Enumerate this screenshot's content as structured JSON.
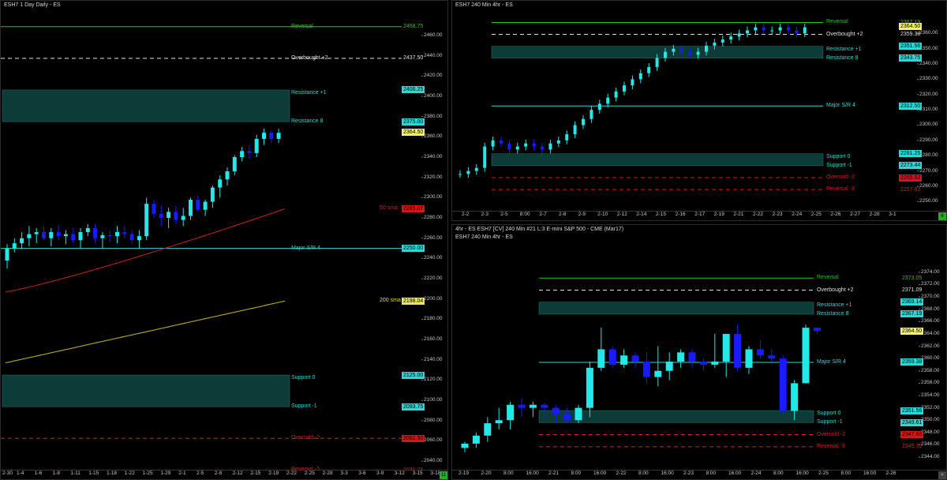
{
  "panels": {
    "daily": {
      "title": "ESH7 1 Day  Daily - ES",
      "levels": [
        {
          "label": "Reversal",
          "price": "2468.75",
          "color": "#22c522",
          "kind": "line",
          "y": 2468.75
        },
        {
          "label": "Overbought +2",
          "price": "2437.50",
          "color": "#e0e0e0",
          "kind": "dash",
          "y": 2437.5
        },
        {
          "label": "Resistance +1",
          "price": "2406.25",
          "color": "#36d3d3",
          "kind": "zone-top",
          "y": 2406.25
        },
        {
          "label": "Resistance 8",
          "price": "2375.00",
          "color": "#36d3d3",
          "kind": "zone-bottom",
          "y": 2375.0
        },
        {
          "label": "Major S/R 4",
          "price": "2250.00",
          "color": "#36d3d3",
          "kind": "line",
          "y": 2250.0
        },
        {
          "label": "Support 0",
          "price": "2125.00",
          "color": "#36d3d3",
          "kind": "zone-top",
          "y": 2125.0
        },
        {
          "label": "Support -1",
          "price": "2093.75",
          "color": "#36d3d3",
          "kind": "zone-bottom",
          "y": 2093.75
        },
        {
          "label": "Oversold -2",
          "price": "2062.50",
          "color": "#d02020",
          "kind": "dash",
          "y": 2062.5
        },
        {
          "label": "Reversal -3",
          "price": "2031.25",
          "color": "#d02020",
          "kind": "dash",
          "y": 2031.25
        }
      ],
      "sma": [
        {
          "label": "50 sma",
          "price": "2289.07",
          "color": "#c8221a"
        },
        {
          "label": "200 sma",
          "price": "2198.04",
          "color": "#b0a020"
        }
      ],
      "last": "2364.50",
      "yticks": [
        "2460.00",
        "2440.00",
        "2420.00",
        "2400.00",
        "2380.00",
        "2360.00",
        "2340.00",
        "2320.00",
        "2300.00",
        "2280.00",
        "2260.00",
        "2240.00",
        "2220.00",
        "2200.00",
        "2180.00",
        "2160.00",
        "2140.00",
        "2120.00",
        "2100.00",
        "2080.00",
        "2060.00",
        "2040.00"
      ],
      "xticks": [
        "1-4",
        "1-6",
        "1-8",
        "1-11",
        "1-15",
        "1-18",
        "1-22",
        "1-25",
        "1-29",
        "2-1",
        "2-5",
        "2-8",
        "2-12",
        "2-15",
        "2-19",
        "2-22",
        "2-25",
        "2-28",
        "3-3",
        "3-6",
        "3-9",
        "3-12",
        "3-15",
        "3-18"
      ],
      "xfirst": "2-30",
      "corner": "11"
    },
    "h4top": {
      "title": "ESH7 240 Min  4hr - ES",
      "levels": [
        {
          "label": "Reversal",
          "price": "2367.19",
          "color": "#22c522",
          "kind": "line"
        },
        {
          "label": "Overbought +2",
          "price": "2359.38",
          "color": "#e0e0e0",
          "kind": "dash"
        },
        {
          "label": "Resistance +1",
          "price": "2351.56",
          "color": "#36d3d3",
          "kind": "zone-top"
        },
        {
          "label": "Resistance 8",
          "price": "2343.75",
          "color": "#36d3d3",
          "kind": "zone-bottom"
        },
        {
          "label": "Major S/R 4",
          "price": "2312.50",
          "color": "#36d3d3",
          "kind": "line"
        },
        {
          "label": "Support 0",
          "price": "2281.25",
          "color": "#36d3d3",
          "kind": "zone-top"
        },
        {
          "label": "Support -1",
          "price": "2273.44",
          "color": "#36d3d3",
          "kind": "zone-bottom"
        },
        {
          "label": "Oversold -2",
          "price": "2265.63",
          "color": "#d02020",
          "kind": "dash"
        },
        {
          "label": "Reversal -3",
          "price": "2257.81",
          "color": "#d02020",
          "kind": "dash"
        }
      ],
      "last": "2364.50",
      "yticks": [
        "2360.00",
        "2350.00",
        "2340.00",
        "2330.00",
        "2320.00",
        "2310.00",
        "2300.00",
        "2290.00",
        "2280.00",
        "2270.00",
        "2260.00",
        "2250.00"
      ],
      "xticks": [
        "2-2",
        "2-3",
        "2-5",
        "8:00",
        "2-7",
        "2-8",
        "2-9",
        "2-10",
        "2-12",
        "2-14",
        "2-15",
        "2-16",
        "2-17",
        "2-19",
        "2-21",
        "2-22",
        "2-23",
        "2-24",
        "2-25",
        "2-26",
        "2-27",
        "2-28",
        "3-1"
      ],
      "corner": "6"
    },
    "h4bot": {
      "title": "4hr - ES  ESH7 [CV]  240 Min  #21  L:3  E-mini S&P 500 - CME (Mar17)",
      "subtitle": "ESH7 240 Min  4hr - ES",
      "levels": [
        {
          "label": "Reversal",
          "price": "2373.05",
          "color": "#22c522",
          "kind": "line"
        },
        {
          "label": "Overbought +2",
          "price": "2371.09",
          "color": "#e0e0e0",
          "kind": "dash"
        },
        {
          "label": "Resistance +1",
          "price": "2369.14",
          "color": "#36d3d3",
          "kind": "zone-top"
        },
        {
          "label": "Resistance 8",
          "price": "2367.19",
          "color": "#36d3d3",
          "kind": "zone-bottom"
        },
        {
          "label": "Major S/R 4",
          "price": "2359.38",
          "color": "#36d3d3",
          "kind": "line"
        },
        {
          "label": "Support 0",
          "price": "2351.56",
          "color": "#36d3d3",
          "kind": "zone-top"
        },
        {
          "label": "Support -1",
          "price": "2349.61",
          "color": "#36d3d3",
          "kind": "zone-bottom"
        },
        {
          "label": "Oversold -2",
          "price": "2347.66",
          "color": "#d02020",
          "kind": "dash"
        },
        {
          "label": "Reversal -3",
          "price": "2345.70",
          "color": "#d02020",
          "kind": "dash"
        }
      ],
      "last": "2364.50",
      "yticks": [
        "2374.00",
        "2372.00",
        "2370.00",
        "2368.00",
        "2366.00",
        "2364.00",
        "2362.00",
        "2360.00",
        "2358.00",
        "2356.00",
        "2354.00",
        "2352.00",
        "2350.00",
        "2348.00",
        "2346.00",
        "2344.00"
      ],
      "xticks": [
        "2-19",
        "2-20",
        "8:00",
        "16:00",
        "2-21",
        "8:00",
        "16:00",
        "2-22",
        "8:00",
        "16:00",
        "2-23",
        "8:00",
        "16:00",
        "2-24",
        "8:00",
        "16:00",
        "2-25",
        "8:00",
        "16:00",
        "2-26"
      ],
      "corner": "×"
    }
  },
  "colors": {
    "bg": "#000000",
    "zone": "#0c3b38",
    "up": "#22e8e8",
    "down": "#1a1aff",
    "last_tag": "#f2f26b",
    "cyan_tag": "#2fd6d6",
    "red_tag": "#d01818",
    "green_tag": "#22b022"
  },
  "chart_data": [
    {
      "type": "candlestick",
      "title": "ESH7 1 Day  Daily - ES",
      "ylim": [
        2030,
        2475
      ],
      "series": [
        {
          "name": "50 sma",
          "last": 2289.07
        },
        {
          "name": "200 sma",
          "last": 2198.04
        }
      ],
      "candles": [
        [
          2238,
          2254,
          2230,
          2250
        ],
        [
          2250,
          2260,
          2246,
          2255
        ],
        [
          2255,
          2266,
          2249,
          2260
        ],
        [
          2260,
          2272,
          2252,
          2264
        ],
        [
          2264,
          2270,
          2255,
          2266
        ],
        [
          2266,
          2272,
          2258,
          2260
        ],
        [
          2260,
          2270,
          2252,
          2266
        ],
        [
          2266,
          2273,
          2258,
          2262
        ],
        [
          2262,
          2268,
          2254,
          2264
        ],
        [
          2264,
          2270,
          2255,
          2258
        ],
        [
          2258,
          2270,
          2250,
          2266
        ],
        [
          2266,
          2274,
          2262,
          2270
        ],
        [
          2270,
          2274,
          2255,
          2260
        ],
        [
          2260,
          2266,
          2250,
          2263
        ],
        [
          2263,
          2268,
          2256,
          2262
        ],
        [
          2262,
          2272,
          2255,
          2266
        ],
        [
          2266,
          2272,
          2260,
          2264
        ],
        [
          2264,
          2268,
          2254,
          2258
        ],
        [
          2258,
          2268,
          2250,
          2262
        ],
        [
          2262,
          2300,
          2258,
          2294
        ],
        [
          2294,
          2298,
          2280,
          2284
        ],
        [
          2284,
          2292,
          2272,
          2280
        ],
        [
          2280,
          2290,
          2270,
          2286
        ],
        [
          2286,
          2292,
          2274,
          2278
        ],
        [
          2278,
          2290,
          2272,
          2282
        ],
        [
          2282,
          2300,
          2278,
          2298
        ],
        [
          2298,
          2302,
          2286,
          2288
        ],
        [
          2288,
          2298,
          2282,
          2296
        ],
        [
          2296,
          2312,
          2290,
          2310
        ],
        [
          2310,
          2322,
          2300,
          2318
        ],
        [
          2318,
          2330,
          2312,
          2326
        ],
        [
          2326,
          2342,
          2322,
          2340
        ],
        [
          2340,
          2350,
          2336,
          2346
        ],
        [
          2346,
          2352,
          2338,
          2344
        ],
        [
          2344,
          2362,
          2340,
          2358
        ],
        [
          2358,
          2368,
          2352,
          2364
        ],
        [
          2364,
          2366,
          2354,
          2358
        ],
        [
          2358,
          2368,
          2354,
          2364
        ]
      ]
    },
    {
      "type": "candlestick",
      "title": "ESH7 240 Min  4hr - ES",
      "ylim": [
        2248,
        2370
      ],
      "candles_note": "4-hour bars 2-2 through 2-24"
    },
    {
      "type": "candlestick",
      "title": "4hr - ES  ESH7 [CV]  240 Min  #21  L:3  E-mini S&P 500 - CME (Mar17)",
      "ylim": [
        2343,
        2375
      ],
      "candles": [
        [
          2345.5,
          2346.5,
          2344.8,
          2346.2
        ],
        [
          2346.2,
          2348.0,
          2345.5,
          2347.5
        ],
        [
          2347.5,
          2350.5,
          2346.5,
          2349.5
        ],
        [
          2349.5,
          2352.0,
          2348.5,
          2350.0
        ],
        [
          2350.0,
          2353.0,
          2348.5,
          2352.5
        ],
        [
          2352.5,
          2353.5,
          2350.5,
          2352.0
        ],
        [
          2352.0,
          2353.0,
          2350.5,
          2352.5
        ],
        [
          2352.5,
          2352.8,
          2350.5,
          2352.0
        ],
        [
          2352.0,
          2352.5,
          2349.5,
          2351.0
        ],
        [
          2351.0,
          2352.0,
          2349.5,
          2350.0
        ],
        [
          2350.0,
          2352.5,
          2349.5,
          2352.0
        ],
        [
          2352.0,
          2359.5,
          2350.5,
          2358.5
        ],
        [
          2358.5,
          2365.0,
          2358.0,
          2361.5
        ],
        [
          2361.5,
          2362.0,
          2358.5,
          2359.0
        ],
        [
          2359.0,
          2361.5,
          2358.5,
          2360.5
        ],
        [
          2360.5,
          2361.0,
          2358.5,
          2359.5
        ],
        [
          2359.5,
          2361.0,
          2356.0,
          2357.0
        ],
        [
          2357.0,
          2362.0,
          2355.5,
          2358.0
        ],
        [
          2358.0,
          2361.0,
          2356.5,
          2359.5
        ],
        [
          2359.5,
          2361.5,
          2358.5,
          2361.0
        ],
        [
          2361.0,
          2361.5,
          2358.5,
          2359.5
        ],
        [
          2359.5,
          2360.0,
          2358.0,
          2359.0
        ],
        [
          2359.0,
          2364.0,
          2358.5,
          2359.5
        ],
        [
          2359.5,
          2364.0,
          2357.0,
          2364.0
        ],
        [
          2364.0,
          2365.5,
          2358.0,
          2358.5
        ],
        [
          2358.5,
          2362.0,
          2357.5,
          2361.5
        ],
        [
          2361.5,
          2363.0,
          2360.0,
          2360.5
        ],
        [
          2360.5,
          2361.5,
          2359.5,
          2360.0
        ],
        [
          2360.0,
          2360.5,
          2351.0,
          2351.5
        ],
        [
          2351.5,
          2356.5,
          2350.0,
          2356.0
        ],
        [
          2356.0,
          2365.5,
          2356.0,
          2365.0
        ],
        [
          2365.0,
          2365.0,
          2364.0,
          2364.5
        ]
      ]
    }
  ]
}
